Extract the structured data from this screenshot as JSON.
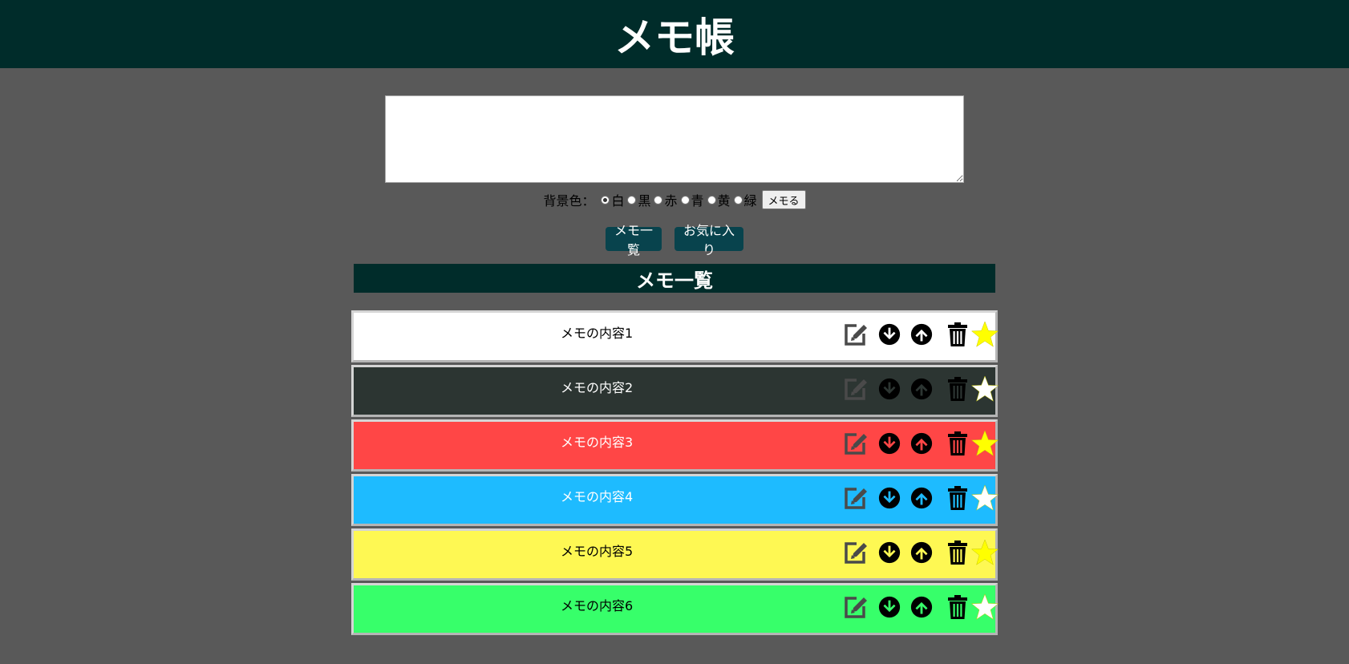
{
  "header": {
    "title": "メモ帳"
  },
  "form": {
    "bg_label": "背景色：",
    "bg_options": [
      "白",
      "黒",
      "赤",
      "青",
      "黄",
      "緑"
    ],
    "selected_bg": "白",
    "submit_label": "メモる",
    "memo_value": ""
  },
  "nav": {
    "list_label": "メモ一覧",
    "favorites_label": "お気に入り"
  },
  "section": {
    "title": "メモ一覧"
  },
  "memos": [
    {
      "text": "メモの内容1",
      "bg": "#ffffff",
      "text_color": "#000000",
      "favorite": true
    },
    {
      "text": "メモの内容2",
      "bg": "#2c3532",
      "text_color": "#ffffff",
      "favorite": false
    },
    {
      "text": "メモの内容3",
      "bg": "#ff4646",
      "text_color": "#ffffff",
      "favorite": true
    },
    {
      "text": "メモの内容4",
      "bg": "#1ebbff",
      "text_color": "#ffffff",
      "favorite": false
    },
    {
      "text": "メモの内容5",
      "bg": "#fef853",
      "text_color": "#000000",
      "favorite": true
    },
    {
      "text": "メモの内容6",
      "bg": "#37ff6a",
      "text_color": "#000000",
      "favorite": false
    }
  ],
  "colors": {
    "header_bg": "#002c2a",
    "page_bg": "#595959",
    "nav_button_bg": "#08434d",
    "star_favorite": "#ffff00",
    "star_default": "#ffffff"
  },
  "icons": [
    "edit-icon",
    "arrow-down-circle-icon",
    "arrow-up-circle-icon",
    "trash-icon",
    "star-icon"
  ]
}
